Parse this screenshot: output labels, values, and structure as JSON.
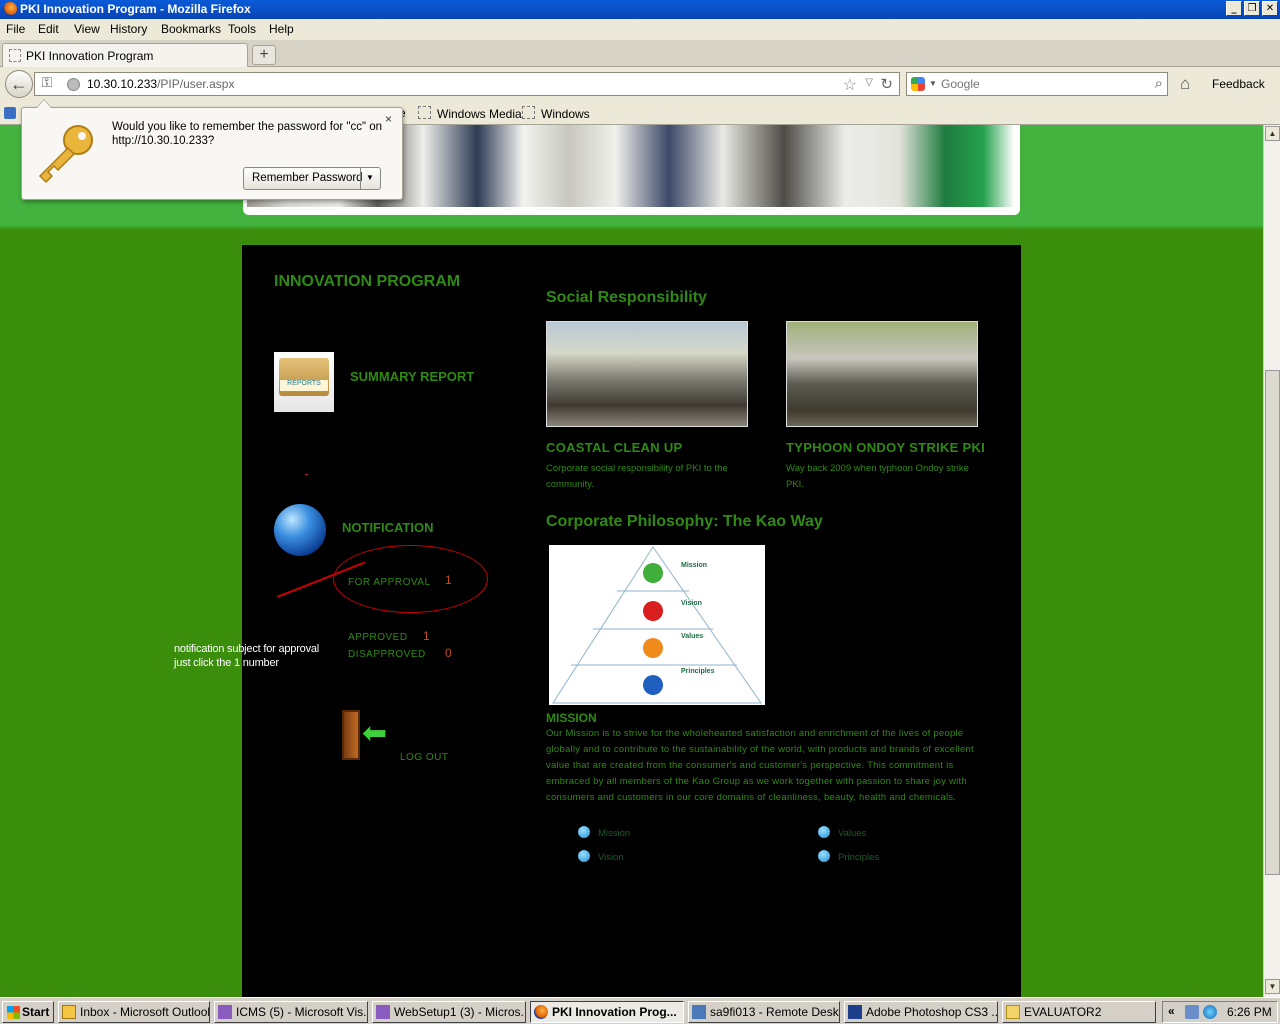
{
  "window": {
    "title": "PKI Innovation Program - Mozilla Firefox",
    "controls": [
      "_",
      "❐",
      "✕"
    ]
  },
  "menu": [
    "File",
    "Edit",
    "View",
    "History",
    "Bookmarks",
    "Tools",
    "Help"
  ],
  "tabs": [
    {
      "label": "PKI Innovation Program"
    }
  ],
  "new_tab_label": "+",
  "nav": {
    "url_host": "10.30.10.233",
    "url_path": "/PIP/user.aspx",
    "search_placeholder": "Google",
    "feedback_label": "Feedback"
  },
  "bookmarks": [
    "Windows Media",
    "Windows"
  ],
  "bookmarks_partial": "e",
  "password_prompt": {
    "message": "Would you like to remember the password for \"cc\" on http://10.30.10.233?",
    "button_label": "Remember Password",
    "close": "×"
  },
  "page": {
    "program_title": "INNOVATION PROGRAM",
    "report_icon_label": "REPORTS",
    "summary_report": "SUMMARY REPORT",
    "notification_title": "NOTIFICATION",
    "for_approval_label": "FOR APPROVAL",
    "for_approval_count": "1",
    "approved_label": "APPROVED",
    "approved_count": "1",
    "disapproved_label": "DISAPPROVED",
    "disapproved_count": "0",
    "logout_label": "LOG OUT",
    "social_title": "Social Responsibility",
    "coastal_title": "COASTAL CLEAN UP",
    "coastal_desc": "Corporate social responsibility of PKI to the community.",
    "typhoon_title": "TYPHOON ONDOY STRIKE PKI",
    "typhoon_desc": "Way back 2009 when typhoon Ondoy strike PKI.",
    "philosophy_title": "Corporate Philosophy: The Kao Way",
    "pyramid": {
      "mission": "Mission",
      "vision": "Vision",
      "values": "Values",
      "principles": "Principles"
    },
    "mission_heading": "MISSION",
    "mission_text": "Our Mission is to strive for the wholehearted satisfaction and enrichment of the lives of people globally and to contribute to the sustainability of the world, with products and brands of excellent value that are created from the consumer's  and customer's perspective. This commitment  is embraced  by all members of  the Kao Group as we work together with passion to share joy with consumers and customers in our core domains of cleanliness, beauty, health and chemicals.",
    "links": [
      "Mission",
      "Values",
      "Vision",
      "Principles"
    ]
  },
  "annotation": {
    "line1": "notification subject for approval",
    "line2": "just click the 1 number"
  },
  "taskbar": {
    "start_label": "Start",
    "tasks": [
      {
        "label": "Inbox - Microsoft Outlook",
        "active": false
      },
      {
        "label": "ICMS (5) - Microsoft Vis...",
        "active": false
      },
      {
        "label": "WebSetup1 (3) - Micros...",
        "active": false
      },
      {
        "label": "PKI Innovation Prog...",
        "active": true
      },
      {
        "label": "sa9fi013 - Remote Desk...",
        "active": false
      },
      {
        "label": "Adobe Photoshop CS3 ...",
        "active": false
      },
      {
        "label": "EVALUATOR2",
        "active": false
      }
    ],
    "tray_chevron": "«",
    "clock": "6:26 PM"
  },
  "colors": {
    "accent_green": "#2f8a13",
    "page_green": "#3a8e0c",
    "count_red": "#c24b1a",
    "annotation_red": "#cc0000"
  }
}
